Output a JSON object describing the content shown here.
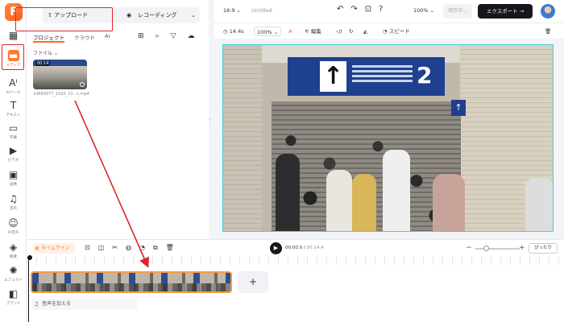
{
  "rail": {
    "logo": "F",
    "items": [
      {
        "name": "layout-icon",
        "label": ""
      },
      {
        "name": "media-icon",
        "label": "メディア"
      },
      {
        "name": "ai-tools-icon",
        "label": "AIツール"
      },
      {
        "name": "text-icon",
        "label": "テキスト"
      },
      {
        "name": "subtitle-icon",
        "label": "字幕"
      },
      {
        "name": "video-icon",
        "label": "ビデオ"
      },
      {
        "name": "image-icon",
        "label": "画像"
      },
      {
        "name": "music-icon",
        "label": "音声"
      },
      {
        "name": "ai-voice-icon",
        "label": "AI音声"
      },
      {
        "name": "element-icon",
        "label": "要素"
      },
      {
        "name": "effect-icon",
        "label": "エフェクト"
      },
      {
        "name": "brand-icon",
        "label": "ブランド"
      }
    ]
  },
  "panel": {
    "upload_label": "アップロード",
    "record_label": "レコーディング",
    "tabs": [
      "プロジェクト",
      "クラウド",
      "AI"
    ],
    "folder_label": "ファイル",
    "media": [
      {
        "duration": "00:14",
        "filename": "14689977_1920_10...s.mp4"
      }
    ]
  },
  "topbar": {
    "aspect_ratio": "16:9",
    "title": "Untitled",
    "zoom": "100%",
    "save_label": "保存中...",
    "export_label": "エクスポート"
  },
  "preview_toolbar": {
    "duration": "14.4s",
    "zoom": "100%",
    "edit_label": "編集",
    "speed_label": "スピード"
  },
  "video": {
    "sign_number": "2",
    "sign_arrow": "↑"
  },
  "timeline": {
    "timeline_label": "タイムライン",
    "current_time": "00:00.0",
    "total_time": "00:14.4",
    "fit_label": "ぴったり",
    "add_audio_label": "音声を加える",
    "add_clip": "+"
  },
  "colors": {
    "accent": "#ff6a1a",
    "annotation": "#e0252b",
    "selection": "#3cd1dc"
  }
}
